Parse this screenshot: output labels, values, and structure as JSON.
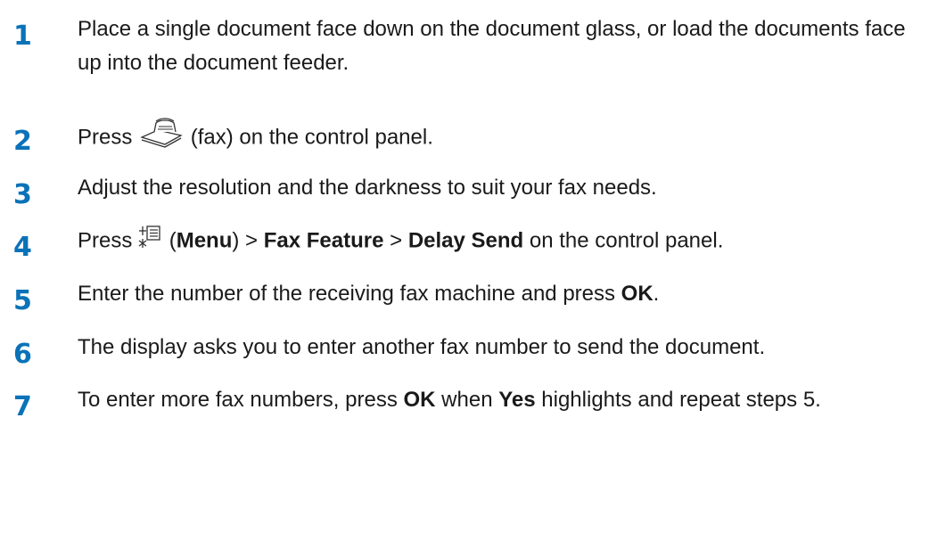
{
  "colors": {
    "step_number": "#0a72b8",
    "body_text": "#1a1a1a"
  },
  "steps": [
    {
      "number": "1",
      "text": "Place a single document face down on the document glass, or load the documents face up into the document feeder."
    },
    {
      "number": "2",
      "prefix": "Press",
      "icon": "fax-icon",
      "suffix": "(fax) on the control panel."
    },
    {
      "number": "3",
      "text": "Adjust the resolution and the darkness to suit your fax needs."
    },
    {
      "number": "4",
      "prefix": "Press",
      "icon": "menu-icon",
      "paren_open": "(",
      "menu": "Menu",
      "paren_close": ")",
      "sep1": ">",
      "item1": "Fax Feature",
      "sep2": ">",
      "item2": "Delay Send",
      "suffix": "on the control panel."
    },
    {
      "number": "5",
      "text": "Enter the number of the receiving fax machine and press",
      "bold": "OK",
      "end": "."
    },
    {
      "number": "6",
      "text": "The display asks you to enter another fax number to send the document."
    },
    {
      "number": "7",
      "text1": "To enter more fax numbers, press",
      "bold1": "OK",
      "text2": "when",
      "bold2": "Yes",
      "text3": "highlights and repeat steps 5."
    }
  ]
}
